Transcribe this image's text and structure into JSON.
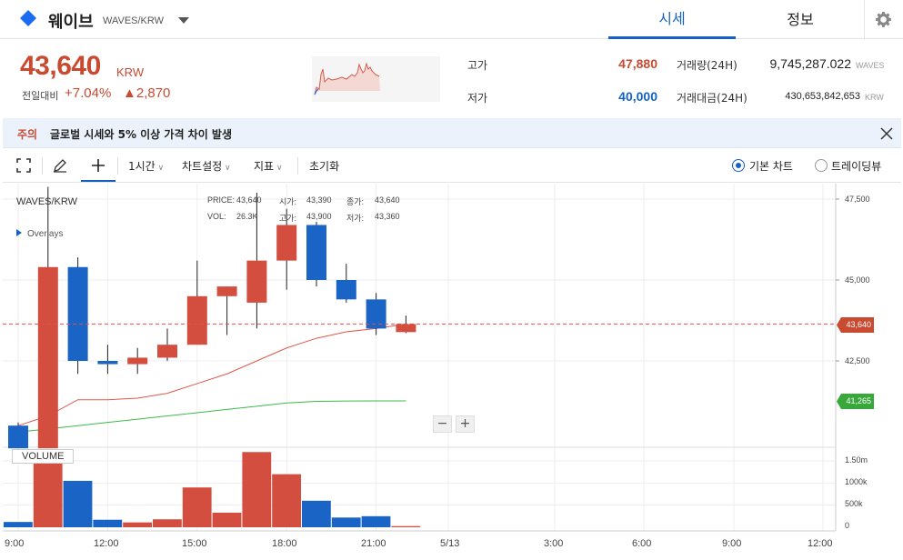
{
  "header": {
    "coin_name": "웨이브",
    "pair": "WAVES/KRW",
    "tabs": [
      {
        "label": "시세",
        "active": true
      },
      {
        "label": "정보",
        "active": false
      }
    ],
    "accent_color": "#1561c3"
  },
  "price": {
    "current": "43,640",
    "unit": "KRW",
    "change_label": "전일대비",
    "change_rate": "+7.04%",
    "change_amount": "▲2,870",
    "up_color": "#c84a31",
    "down_color": "#1561c3"
  },
  "stats": {
    "high_label": "고가",
    "high_value": "47,880",
    "low_label": "저가",
    "low_value": "40,000",
    "volume_label": "거래량(24H)",
    "volume_value": "9,745,287.022",
    "volume_unit": "WAVES",
    "amount_label": "거래대금(24H)",
    "amount_value": "430,653,842,653",
    "amount_unit": "KRW"
  },
  "notice": {
    "tag": "주의",
    "text": "글로벌 시세와 5% 이상 가격 차이 발생"
  },
  "toolbar": {
    "interval": "1시간",
    "chart_settings": "차트설정",
    "indicators": "지표",
    "reset": "초기화",
    "radio_basic": "기본 차트",
    "radio_tradingview": "트레이딩뷰"
  },
  "chart": {
    "pair_label": "WAVES/KRW",
    "overlays_label": "Overlays",
    "ohlc": {
      "price_label": "PRICE:",
      "price": "43,640",
      "open_label": "시가:",
      "open": "43,390",
      "close_label": "종가:",
      "close": "43,640",
      "vol_label": "VOL:",
      "vol": "26.3K",
      "high_label": "고가:",
      "high": "43,900",
      "low_label": "저가:",
      "low": "43,360"
    },
    "zoom_out": "−",
    "zoom_in": "+",
    "volume_label": "VOLUME",
    "y_ticks": [
      "47,500",
      "45,000",
      "42,500"
    ],
    "last_price_tag": "43,640",
    "ma_tag": "41,265",
    "vol_ticks": [
      "1.50m",
      "1000k",
      "500k",
      "0"
    ],
    "x_ticks": [
      "9:00",
      "12:00",
      "15:00",
      "18:00",
      "21:00",
      "5/13",
      "3:00",
      "6:00",
      "9:00",
      "12:00"
    ]
  },
  "chart_data": {
    "type": "candlestick",
    "title": "WAVES/KRW",
    "x_unit": "hour",
    "price_range": [
      40000,
      48000
    ],
    "volume_range": [
      0,
      1800000
    ],
    "candles": [
      {
        "time": "09:00",
        "open": 40500,
        "high": 40600,
        "low": 39800,
        "close": 39800,
        "volume": 120000
      },
      {
        "time": "10:00",
        "open": 39800,
        "high": 47880,
        "low": 39800,
        "close": 45400,
        "volume": 1450000
      },
      {
        "time": "11:00",
        "open": 45400,
        "high": 45700,
        "low": 42100,
        "close": 42500,
        "volume": 1050000
      },
      {
        "time": "12:00",
        "open": 42500,
        "high": 43000,
        "low": 42100,
        "close": 42400,
        "volume": 170000
      },
      {
        "time": "13:00",
        "open": 42400,
        "high": 42900,
        "low": 42100,
        "close": 42600,
        "volume": 110000
      },
      {
        "time": "14:00",
        "open": 42600,
        "high": 43500,
        "low": 42500,
        "close": 43000,
        "volume": 180000
      },
      {
        "time": "15:00",
        "open": 43000,
        "high": 45600,
        "low": 43000,
        "close": 44500,
        "volume": 900000
      },
      {
        "time": "16:00",
        "open": 44500,
        "high": 44800,
        "low": 43300,
        "close": 44800,
        "volume": 330000
      },
      {
        "time": "17:00",
        "open": 44300,
        "high": 47700,
        "low": 43500,
        "close": 45600,
        "volume": 1700000
      },
      {
        "time": "18:00",
        "open": 45600,
        "high": 47200,
        "low": 44700,
        "close": 46700,
        "volume": 1200000
      },
      {
        "time": "19:00",
        "open": 46700,
        "high": 46800,
        "low": 44800,
        "close": 45000,
        "volume": 600000
      },
      {
        "time": "20:00",
        "open": 45000,
        "high": 45500,
        "low": 44300,
        "close": 44400,
        "volume": 220000
      },
      {
        "time": "21:00",
        "open": 44400,
        "high": 44600,
        "low": 43300,
        "close": 43500,
        "volume": 250000
      },
      {
        "time": "22:00",
        "open": 43390,
        "high": 43900,
        "low": 43360,
        "close": 43640,
        "volume": 26300
      }
    ],
    "ma_short": [
      40500,
      40800,
      41300,
      41300,
      41350,
      41500,
      41800,
      42100,
      42500,
      42900,
      43200,
      43400,
      43500,
      43640
    ],
    "ma_long": [
      40300,
      40400,
      40500,
      40600,
      40700,
      40800,
      40900,
      41000,
      41100,
      41200,
      41250,
      41260,
      41265,
      41265
    ],
    "last_price": 43640,
    "colors": {
      "up": "#d44e3f",
      "down": "#1964c5",
      "ma_short": "#e0584a",
      "ma_long": "#3dbb4a",
      "last_line": "#e05050"
    }
  }
}
